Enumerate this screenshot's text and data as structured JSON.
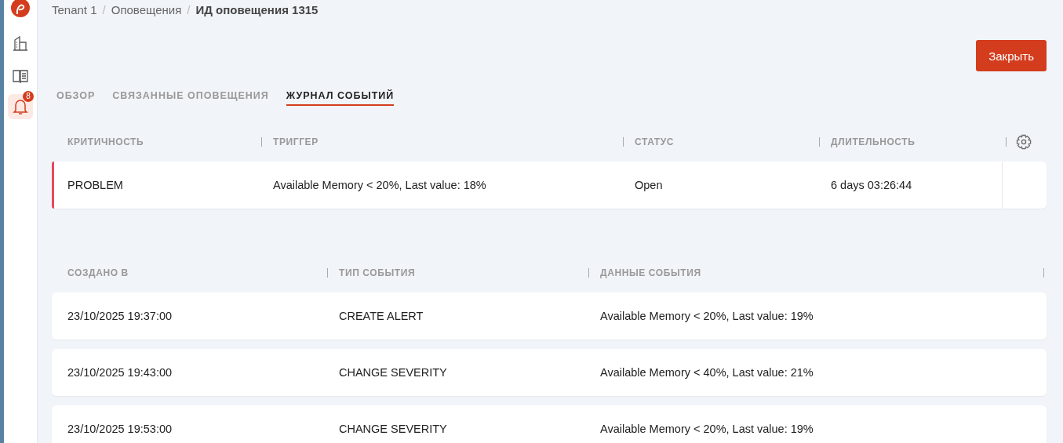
{
  "sidebar": {
    "notification_badge": "8"
  },
  "breadcrumb": [
    {
      "kind": "link",
      "label": "Tenant 1",
      "current": false
    },
    {
      "kind": "separator",
      "label": "/"
    },
    {
      "kind": "link",
      "label": "Оповещения",
      "current": false
    },
    {
      "kind": "separator",
      "label": "/"
    },
    {
      "kind": "link",
      "label": "ИД оповещения 1315",
      "current": true
    }
  ],
  "close_button": "Закрыть",
  "tabs": [
    {
      "label": "ОБЗОР",
      "selected": false
    },
    {
      "label": "СВЯЗАННЫЕ ОПОВЕЩЕНИЯ",
      "selected": false
    },
    {
      "label": "ЖУРНАЛ СОБЫТИЙ",
      "selected": true
    }
  ],
  "alert_table": {
    "columns": [
      "КРИТИЧНОСТЬ",
      "ТРИГГЕР",
      "СТАТУС",
      "ДЛИТЕЛЬНОСТЬ"
    ],
    "rows": [
      {
        "color": "#e8485f",
        "cells": [
          "PROBLEM",
          "Available Memory < 20%, Last value: 18%",
          "Open",
          "6 days 03:26:44"
        ]
      }
    ]
  },
  "events_table": {
    "columns": [
      "СОЗДАНО В",
      "ТИП СОБЫТИЯ",
      "ДАННЫЕ СОБЫТИЯ"
    ],
    "rows": [
      {
        "cells": [
          "23/10/2025 19:37:00",
          "CREATE ALERT",
          "Available Memory < 20%, Last value: 19%"
        ]
      },
      {
        "cells": [
          "23/10/2025 19:43:00",
          "CHANGE SEVERITY",
          "Available Memory < 40%, Last value: 21%"
        ]
      },
      {
        "cells": [
          "23/10/2025 19:53:00",
          "CHANGE SEVERITY",
          "Available Memory < 20%, Last value: 19%"
        ]
      }
    ]
  }
}
